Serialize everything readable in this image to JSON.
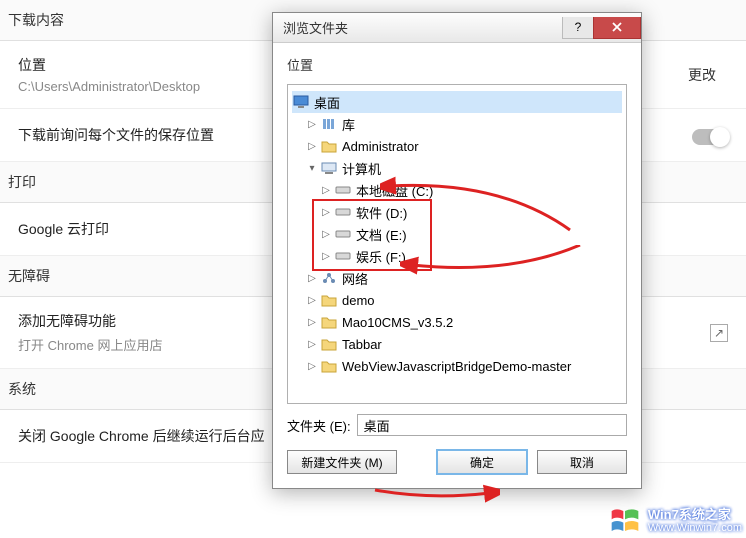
{
  "background": {
    "section_download": "下载内容",
    "location_label": "位置",
    "location_path": "C:\\Users\\Administrator\\Desktop",
    "change_label": "更改",
    "ask_location_label": "下载前询问每个文件的保存位置",
    "section_print": "打印",
    "cloud_print_label": "Google 云打印",
    "section_a11y": "无障碍",
    "a11y_title": "添加无障碍功能",
    "a11y_sub": "打开 Chrome 网上应用店",
    "section_system": "系统",
    "bg_run_label": "关闭 Google Chrome 后继续运行后台应"
  },
  "dialog": {
    "title": "浏览文件夹",
    "heading": "位置",
    "folder_label": "文件夹 (E):",
    "folder_value": "桌面",
    "btn_new": "新建文件夹 (M)",
    "btn_ok": "确定",
    "btn_cancel": "取消",
    "tree": {
      "desktop": "桌面",
      "library": "库",
      "admin": "Administrator",
      "computer": "计算机",
      "c": "本地磁盘 (C:)",
      "d": "软件 (D:)",
      "e": "文档 (E:)",
      "f": "娱乐 (F:)",
      "network": "网络",
      "demo": "demo",
      "mao": "Mao10CMS_v3.5.2",
      "tabbar": "Tabbar",
      "webview": "WebViewJavascriptBridgeDemo-master"
    }
  },
  "watermark": {
    "line1": "Win7系统之家",
    "line2": "Www.Winwin7.com"
  }
}
